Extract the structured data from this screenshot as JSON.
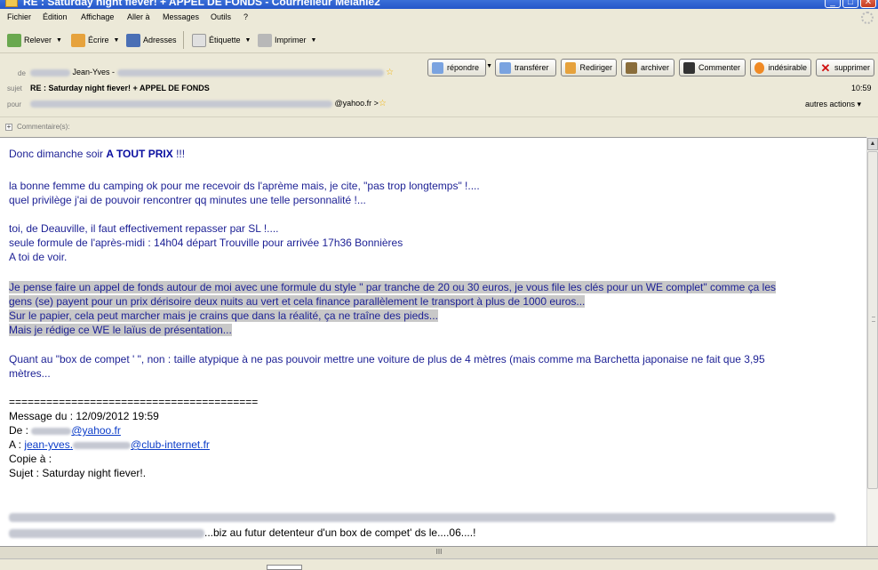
{
  "window": {
    "title": "RE : Saturday night fiever! + APPEL DE FONDS - Courrielleur Mélanie2"
  },
  "menu": [
    "Fichier",
    "Édition",
    "Affichage",
    "Aller à",
    "Messages",
    "Outils",
    "?"
  ],
  "toolbar": {
    "relever": "Relever",
    "ecrire": "Écrire",
    "adresses": "Adresses",
    "etiquette": "Étiquette",
    "imprimer": "Imprimer"
  },
  "header": {
    "from_label": "de",
    "from_name": "Jean-Yves -",
    "subject_label": "sujet",
    "subject": "RE : Saturday night fiever! + APPEL DE FONDS",
    "time": "10:59",
    "to_label": "pour",
    "to_visible": "@yahoo.fr >",
    "other_actions": "autres actions",
    "actions": {
      "reply": "répondre",
      "forward": "transférer",
      "redirect": "Rediriger",
      "archive": "archiver",
      "comment": "Commenter",
      "junk": "indésirable",
      "delete": "supprimer"
    }
  },
  "comments": {
    "label": "Commentaire(s):"
  },
  "message": {
    "l1_pre": "Donc dimanche soir ",
    "l1_bold": "A TOUT PRIX",
    "l1_post": " !!!",
    "l2": "la bonne femme du camping ok pour me recevoir ds l'aprème mais, je cite, \"pas trop longtemps\" !....",
    "l3": "quel privilège j'ai de pouvoir rencontrer qq minutes une telle personnalité !...",
    "l4": "toi, de Deauville, il faut effectivement repasser par SL !....",
    "l5": "seule formule de l'après-midi : 14h04 départ Trouville pour arrivée 17h36 Bonnières",
    "l6": "A toi de voir.",
    "l7": "Je pense faire un appel de fonds autour de moi avec une formule du style \" par tranche de 20 ou 30 euros, je vous file les clés pour un WE complet\" comme ça les",
    "l8": "gens (se) payent pour un prix dérisoire deux nuits au vert et cela finance parallèlement le transport à plus de 1000 euros...",
    "l9": "Sur le papier, cela peut marcher mais je crains que dans la réalité, ça ne traîne des pieds...",
    "l10": "Mais je rédige ce WE le laïus de présentation...",
    "l11": "Quant au \"box de compet ' \", non : taille atypique à ne pas pouvoir mettre une voiture de plus de 4 mètres (mais comme ma Barchetta japonaise ne fait que 3,95",
    "l12": "mètres...",
    "separator": "========================================",
    "q_date": "Message du : 12/09/2012 19:59",
    "q_from_label": "De : ",
    "q_from_email": "@yahoo.fr",
    "q_to_label": "A : ",
    "q_to_email_start": "jean-yves.",
    "q_to_email_end": "@club-internet.fr",
    "q_cc": "Copie à :",
    "q_subject": "Sujet : Saturday night fiever!.",
    "q_last": "...biz au futur detenteur d'un box de compet' ds le....06....!"
  },
  "splitter": {
    "grip": "III"
  }
}
